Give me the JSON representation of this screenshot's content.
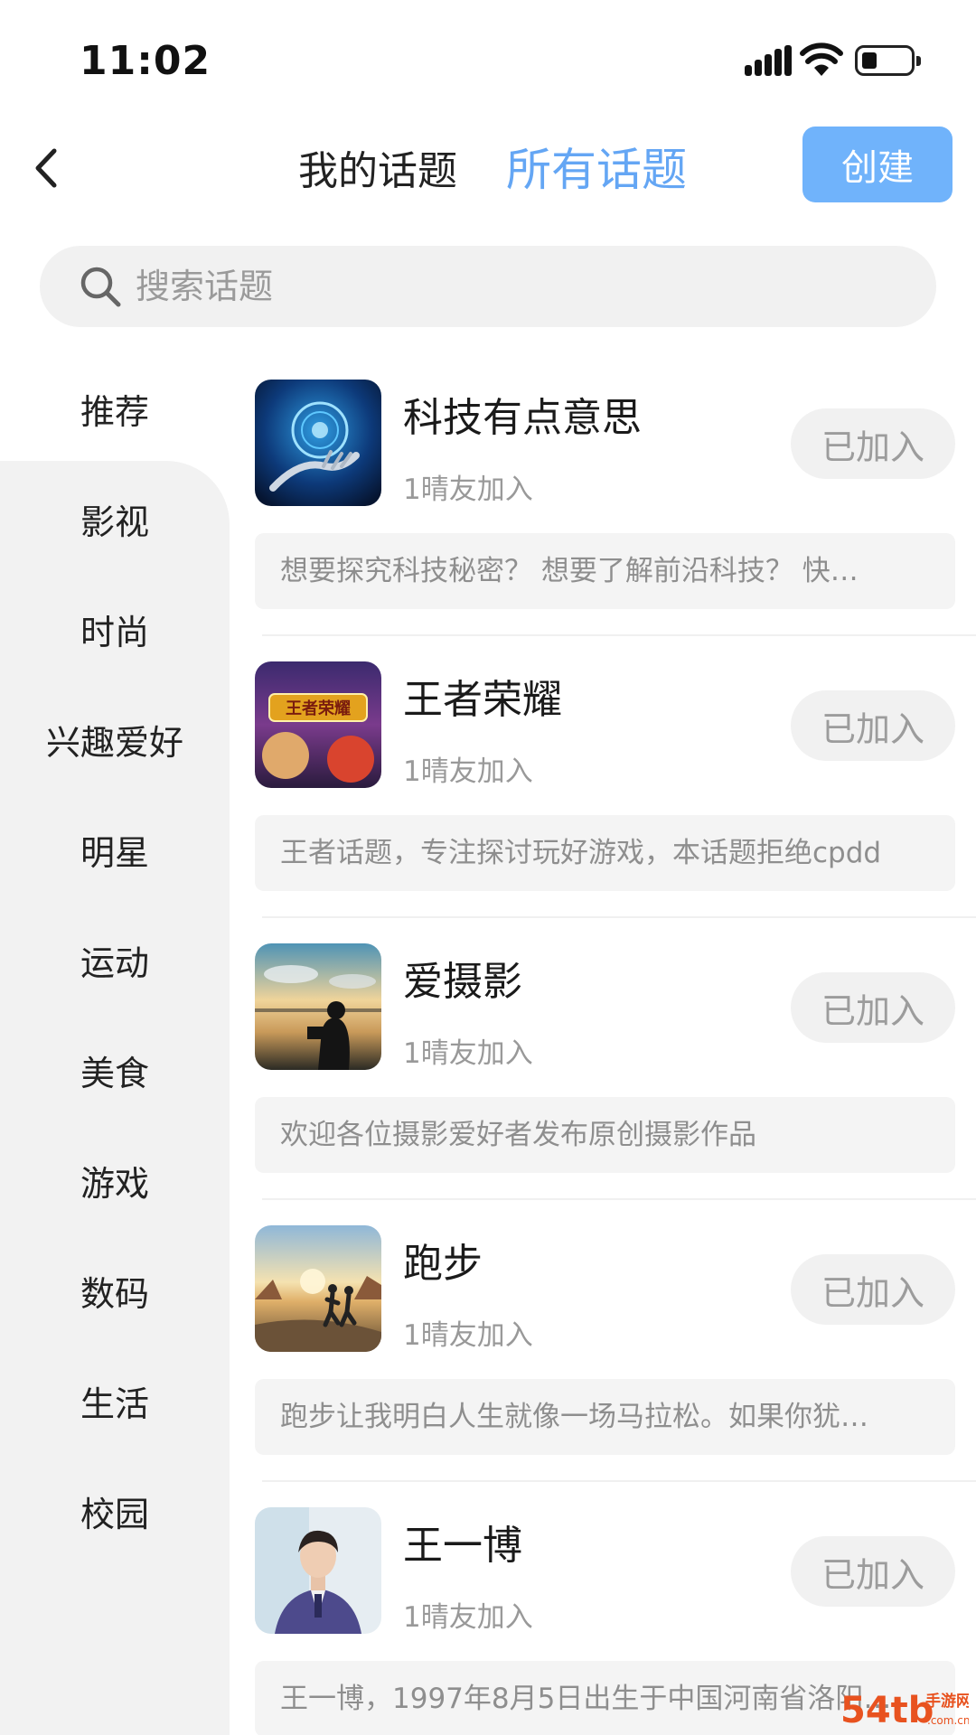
{
  "status_bar": {
    "time": "11:02"
  },
  "header": {
    "tabs": [
      {
        "label": "我的话题",
        "active": false
      },
      {
        "label": "所有话题",
        "active": true
      }
    ],
    "create_label": "创建"
  },
  "search": {
    "placeholder": "搜索话题"
  },
  "sidebar": {
    "items": [
      {
        "label": "推荐",
        "active": true
      },
      {
        "label": "影视"
      },
      {
        "label": "时尚"
      },
      {
        "label": "兴趣爱好"
      },
      {
        "label": "明星"
      },
      {
        "label": "运动"
      },
      {
        "label": "美食"
      },
      {
        "label": "游戏"
      },
      {
        "label": "数码"
      },
      {
        "label": "生活"
      },
      {
        "label": "校园"
      }
    ]
  },
  "topics": [
    {
      "name": "科技有点意思",
      "members": "1晴友加入",
      "status": "已加入",
      "description": "想要探究科技秘密？ 想要了解前沿科技？ 快…"
    },
    {
      "name": "王者荣耀",
      "members": "1晴友加入",
      "status": "已加入",
      "description": "王者话题，专注探讨玩好游戏，本话题拒绝cpdd",
      "thumb_text": "王者荣耀"
    },
    {
      "name": "爱摄影",
      "members": "1晴友加入",
      "status": "已加入",
      "description": "欢迎各位摄影爱好者发布原创摄影作品"
    },
    {
      "name": "跑步",
      "members": "1晴友加入",
      "status": "已加入",
      "description": "跑步让我明白人生就像一场马拉松。如果你犹…"
    },
    {
      "name": "王一博",
      "members": "1晴友加入",
      "status": "已加入",
      "description": "王一博，1997年8月5日出生于中国河南省洛阳…"
    }
  ],
  "watermark": {
    "text": "54tb",
    "subtext": "手游网",
    "domain": ".com.cn"
  },
  "colors": {
    "accent": "#70b3fb",
    "active_tab": "#64a6f4",
    "muted": "#9c9c9c",
    "watermark": "#e8521f"
  }
}
